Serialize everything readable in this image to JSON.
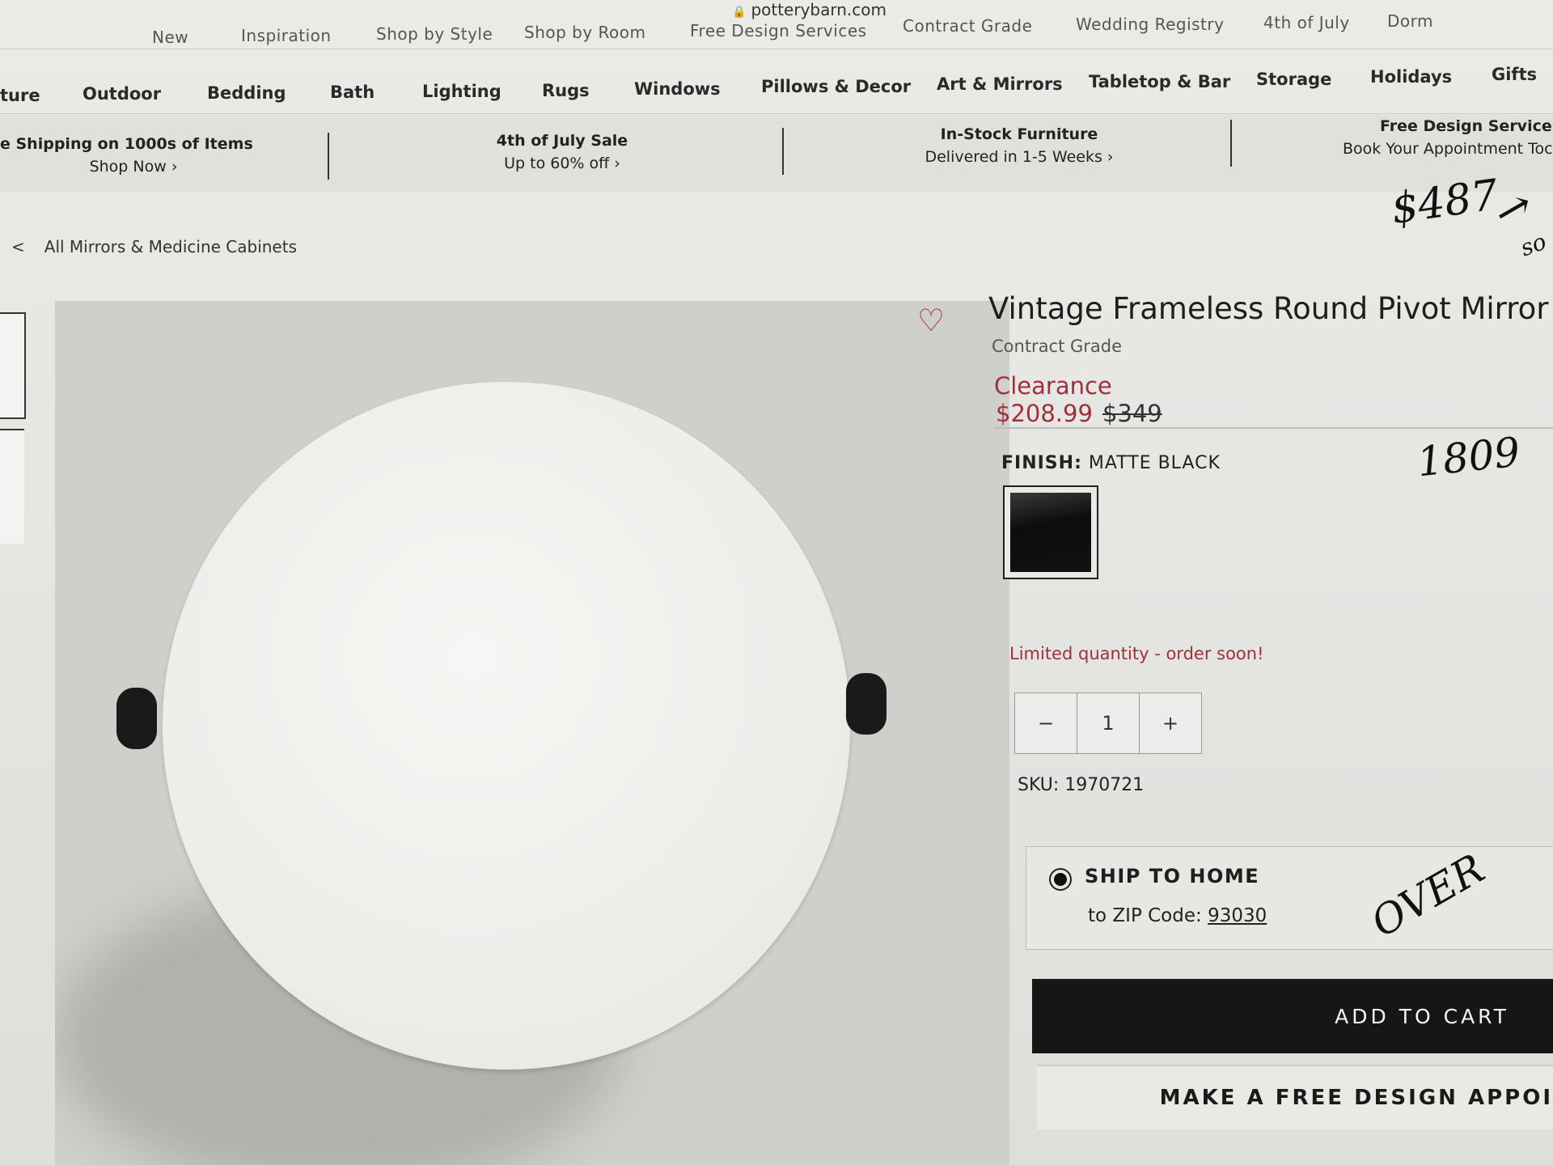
{
  "browser": {
    "url": "potterybarn.com"
  },
  "top_nav": [
    "New",
    "Inspiration",
    "Shop by Style",
    "Shop by Room",
    "Free Design Services",
    "Contract Grade",
    "Wedding Registry",
    "4th of July",
    "Dorm"
  ],
  "category_nav": [
    "ture",
    "Outdoor",
    "Bedding",
    "Bath",
    "Lighting",
    "Rugs",
    "Windows",
    "Pillows & Decor",
    "Art & Mirrors",
    "Tabletop & Bar",
    "Storage",
    "Holidays",
    "Gifts"
  ],
  "promos": [
    {
      "title": "e Shipping on 1000s of Items",
      "link": "Shop Now ›"
    },
    {
      "title": "4th of July Sale",
      "link": "Up to 60% off ›"
    },
    {
      "title": "In-Stock Furniture",
      "link": "Delivered in 1-5 Weeks ›"
    },
    {
      "title": "Free Design Services",
      "link": "Book Your Appointment Toc"
    }
  ],
  "breadcrumb": {
    "chevron": "<",
    "label": "All Mirrors & Medicine Cabinets"
  },
  "product": {
    "title": "Vintage Frameless Round Pivot Mirror",
    "subtitle": "Contract Grade",
    "badge": "Clearance",
    "sale_price": "$208.99",
    "original_price": "$349",
    "finish_label": "FINISH:",
    "finish_value": "MATTE BLACK",
    "stock_note": "Limited quantity - order soon!",
    "quantity": {
      "minus": "−",
      "value": "1",
      "plus": "+"
    },
    "sku": "SKU: 1970721"
  },
  "shipping": {
    "label": "SHIP TO HOME",
    "zip_prefix": "to ZIP Code: ",
    "zip": "93030"
  },
  "buttons": {
    "add_to_cart": "ADD TO CART",
    "design": "MAKE A FREE DESIGN APPOI"
  },
  "handwritten": {
    "price_note": "$487",
    "arrow": "→",
    "so": "so",
    "number": "1809",
    "over": "OVER"
  },
  "colors": {
    "sale_red": "#a0303a",
    "button_black": "#161616"
  }
}
